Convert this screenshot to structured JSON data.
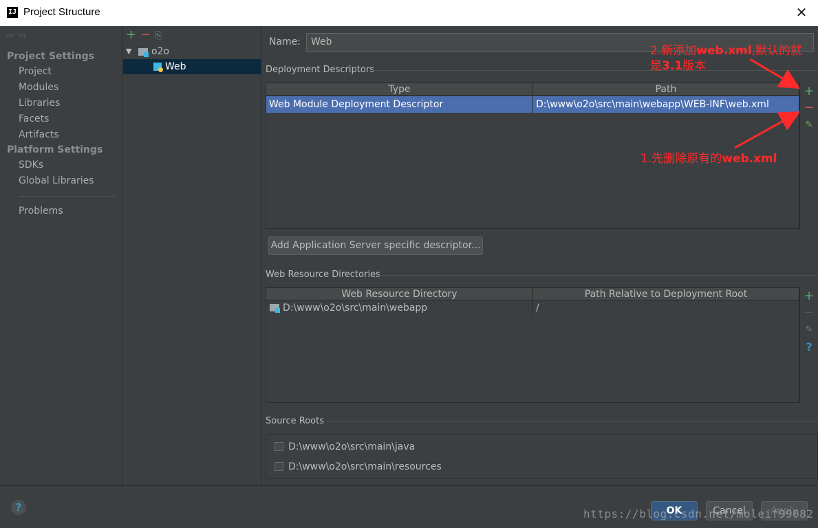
{
  "window": {
    "title": "Project Structure",
    "close_glyph": "✕",
    "app_glyph": "IJ"
  },
  "nav": {
    "back_glyph": "⇦",
    "forward_glyph": "⇨",
    "project_settings_title": "Project Settings",
    "project_items": [
      "Project",
      "Modules",
      "Libraries",
      "Facets",
      "Artifacts"
    ],
    "platform_settings_title": "Platform Settings",
    "platform_items": [
      "SDKs",
      "Global Libraries"
    ],
    "problems": "Problems"
  },
  "tree": {
    "add_glyph": "+",
    "remove_glyph": "−",
    "copy_glyph": "⎘",
    "caret_glyph": "▼",
    "module": "o2o",
    "facet": "Web"
  },
  "main": {
    "name_label": "Name:",
    "name_value": "Web",
    "deployment_descriptors_label": "Deployment Descriptors",
    "descriptor_table": {
      "columns": [
        "Type",
        "Path"
      ],
      "rows": [
        {
          "type": "Web Module Deployment Descriptor",
          "path": "D:\\www\\o2o\\src\\main\\webapp\\WEB-INF\\web.xml"
        }
      ]
    },
    "add_server_descriptor_button": "Add Application Server specific descriptor...",
    "web_resource_label": "Web Resource Directories",
    "resource_table": {
      "columns": [
        "Web Resource Directory",
        "Path Relative to Deployment Root"
      ],
      "rows": [
        {
          "directory": "D:\\www\\o2o\\src\\main\\webapp",
          "relative": "/"
        }
      ]
    },
    "source_roots_label": "Source Roots",
    "source_roots": [
      "D:\\www\\o2o\\src\\main\\java",
      "D:\\www\\o2o\\src\\main\\resources"
    ]
  },
  "tools": {
    "plus": "+",
    "minus": "−",
    "edit": "✎",
    "help": "?"
  },
  "footer": {
    "help_glyph": "?",
    "ok_label": "OK",
    "cancel_label": "Cancel",
    "apply_label": "Apply"
  },
  "annotations": {
    "step2_prefix": "2.新添加",
    "step2_bold": "web.xml",
    "step2_suffix": ",默认的就",
    "step2_line2_prefix": "是",
    "step2_line2_bold": "3.1",
    "step2_line2_suffix": "版本",
    "step1_prefix": "1.先删除原有的",
    "step1_bold": "web.xml"
  },
  "watermark": "https://blog.csdn.net/moleif99082",
  "colors": {
    "background": "#3c3f41",
    "selection": "#4b6eaf",
    "annotation": "#ff2a2a",
    "add": "#59a869",
    "remove": "#c75450"
  }
}
